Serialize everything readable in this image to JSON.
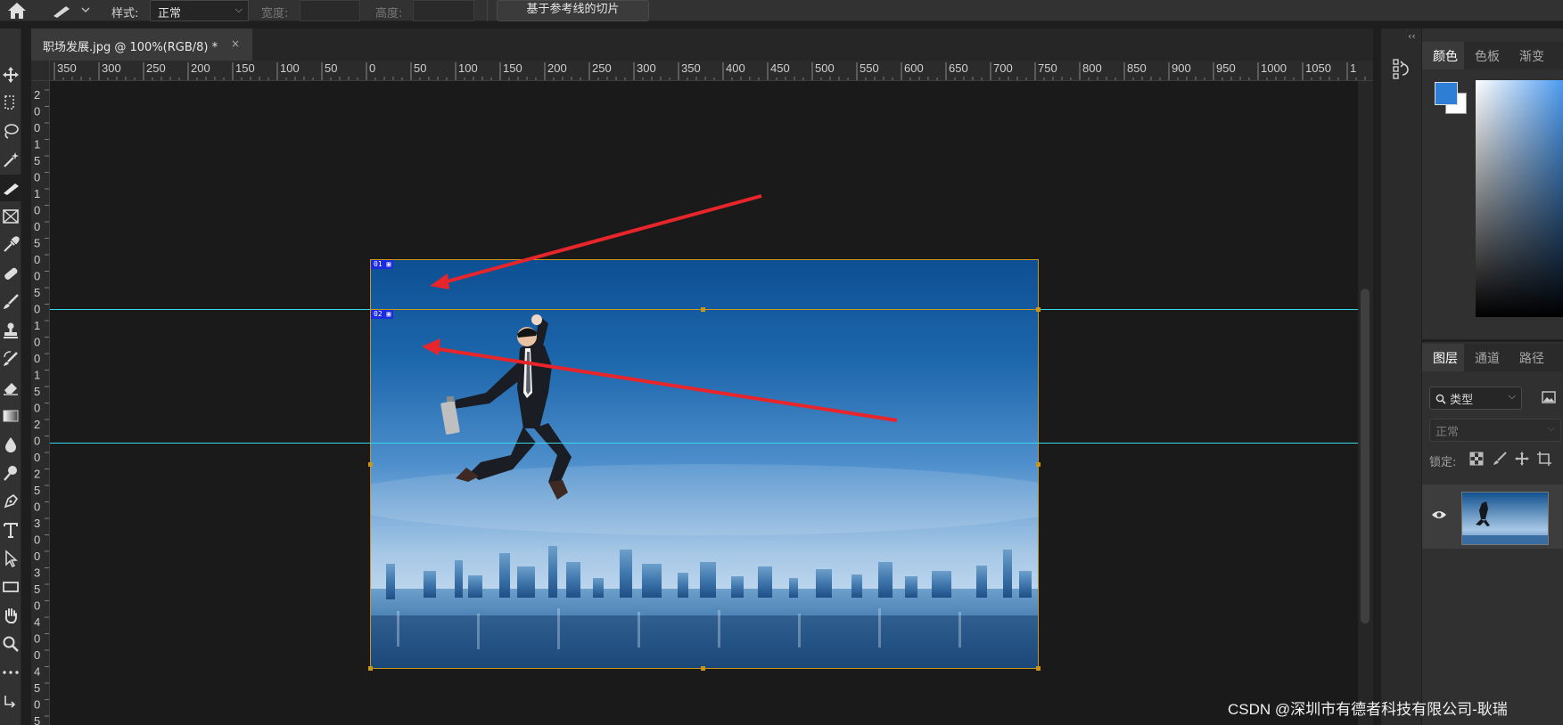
{
  "options_bar": {
    "style_label": "样式:",
    "style_value": "正常",
    "width_label": "宽度:",
    "height_label": "高度:",
    "slice_guides_button": "基于参考线的切片"
  },
  "tools": [
    {
      "name": "move-tool",
      "icon": "move-icon"
    },
    {
      "name": "marquee-tool",
      "icon": "marquee-icon"
    },
    {
      "name": "lasso-tool",
      "icon": "lasso-icon"
    },
    {
      "name": "magic-wand-tool",
      "icon": "magic-wand-icon"
    },
    {
      "name": "slice-tool",
      "icon": "slice-knife-icon",
      "active": true
    },
    {
      "name": "frame-tool",
      "icon": "frame-icon"
    },
    {
      "name": "eyedropper-tool",
      "icon": "eyedropper-icon"
    },
    {
      "name": "healing-brush-tool",
      "icon": "bandage-icon"
    },
    {
      "name": "brush-tool",
      "icon": "brush-icon"
    },
    {
      "name": "clone-stamp-tool",
      "icon": "stamp-icon"
    },
    {
      "name": "history-brush-tool",
      "icon": "history-brush-icon"
    },
    {
      "name": "eraser-tool",
      "icon": "eraser-icon"
    },
    {
      "name": "gradient-tool",
      "icon": "gradient-icon"
    },
    {
      "name": "blur-tool",
      "icon": "drop-icon"
    },
    {
      "name": "dodge-tool",
      "icon": "dodge-icon"
    },
    {
      "name": "pen-tool",
      "icon": "pen-icon"
    },
    {
      "name": "type-tool",
      "icon": "type-icon"
    },
    {
      "name": "path-selection-tool",
      "icon": "arrow-icon"
    },
    {
      "name": "rectangle-tool",
      "icon": "rectangle-icon"
    },
    {
      "name": "hand-tool",
      "icon": "hand-icon"
    },
    {
      "name": "zoom-tool",
      "icon": "zoom-icon"
    },
    {
      "name": "more-tools",
      "icon": "ellipsis-icon"
    },
    {
      "name": "swap-colors",
      "icon": "swap-icon"
    }
  ],
  "document_tab": {
    "title": "职场发展.jpg @ 100%(RGB/8) *",
    "close_glyph": "×"
  },
  "ruler": {
    "top_ticks": [
      "350",
      "300",
      "250",
      "200",
      "150",
      "100",
      "50",
      "0",
      "50",
      "100",
      "150",
      "200",
      "250",
      "300",
      "350",
      "400",
      "450",
      "500",
      "550",
      "600",
      "650",
      "700",
      "750",
      "800",
      "850",
      "900",
      "950",
      "1000",
      "1050",
      "1"
    ],
    "left_digits": [
      "2",
      "0",
      "0",
      "1",
      "5",
      "0",
      "1",
      "0",
      "0",
      "5",
      "0",
      "0",
      "5",
      "0",
      "1",
      "0",
      "0",
      "1",
      "5",
      "0",
      "2",
      "0",
      "0",
      "2",
      "5",
      "0",
      "3",
      "0",
      "0",
      "3",
      "5",
      "0",
      "4",
      "0",
      "0",
      "4",
      "5",
      "0",
      "5"
    ]
  },
  "slices": [
    {
      "label": "01"
    },
    {
      "label": "02"
    }
  ],
  "right_panel": {
    "color_tabs": [
      "颜色",
      "色板",
      "渐变"
    ],
    "foreground_color": "#2f7ed6",
    "background_color": "#ffffff",
    "layers_tabs": [
      "图层",
      "通道",
      "路径"
    ],
    "filter_label": "类型",
    "blend_mode": "正常",
    "lock_label": "锁定:",
    "layer_thumbnail": "business-man-jump-thumbnail"
  },
  "watermark": "CSDN @深圳市有德者科技有限公司-耿瑞",
  "colors": {
    "guide": "#35d8ec",
    "slice_border": "#c89618",
    "slice_tag": "#1c2ae0",
    "arrow": "#e8252b",
    "accent": "#2f7ed6"
  }
}
